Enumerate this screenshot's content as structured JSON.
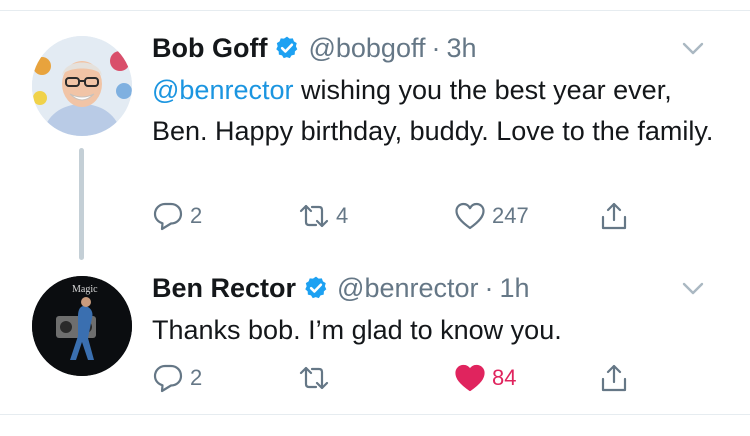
{
  "colors": {
    "text": "#14171a",
    "secondary": "#657786",
    "link": "#1b95e0",
    "verified": "#1da1f2",
    "like": "#e0245e",
    "divider": "#e6ecf0",
    "thread_line": "#c4cfd6"
  },
  "tweets": [
    {
      "author_name": "Bob Goff",
      "handle": "@bobgoff",
      "separator": "·",
      "time": "3h",
      "mention": "@benrector",
      "text": " wishing you the best year ever, Ben. Happy birthday, buddy. Love to the family.",
      "avatar_icon": "avatar-photo",
      "replies": "2",
      "retweets": "4",
      "likes": "247",
      "liked": false
    },
    {
      "author_name": "Ben Rector",
      "handle": "@benrector",
      "separator": "·",
      "time": "1h",
      "text": "Thanks bob. I’m glad to know you.",
      "avatar_icon": "avatar-album-art",
      "avatar_text": "Magic",
      "replies": "2",
      "retweets": "",
      "likes": "84",
      "liked": true
    }
  ]
}
